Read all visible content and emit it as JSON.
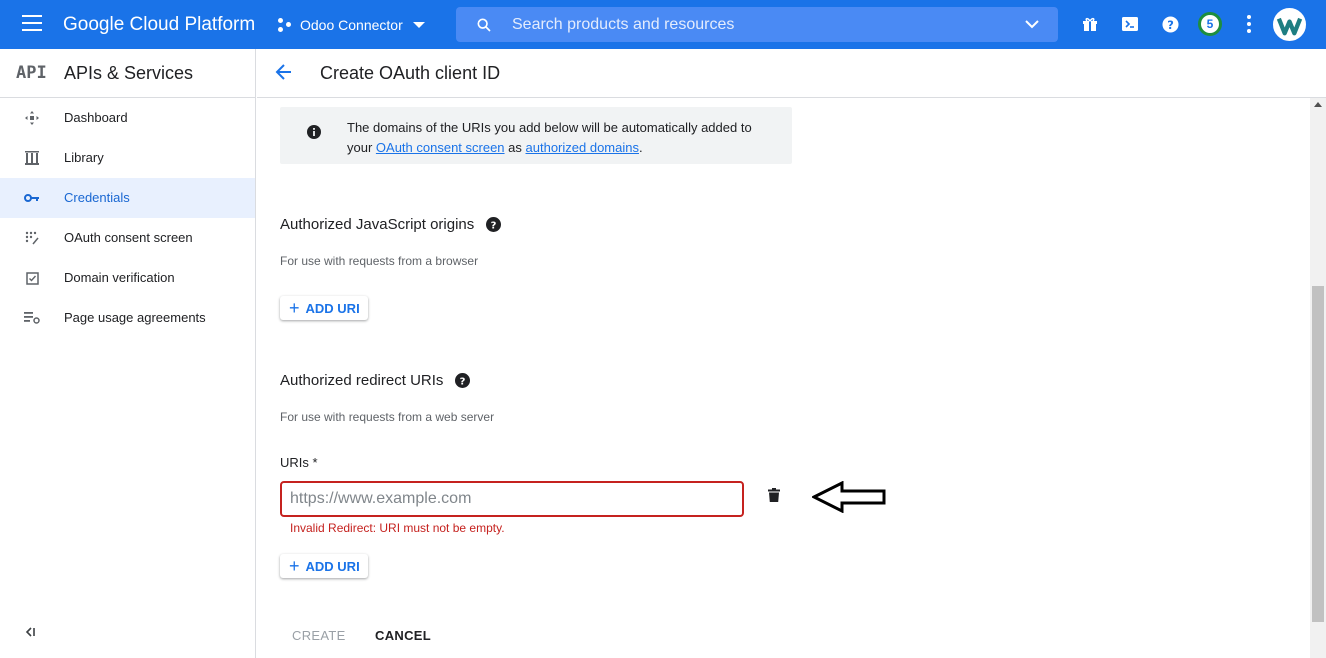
{
  "topbar": {
    "brand": "Google Cloud Platform",
    "project": "Odoo Connector",
    "search_placeholder": "Search products and resources",
    "notifications_count": "5"
  },
  "sidebar": {
    "logo": "API",
    "title": "APIs & Services",
    "items": [
      {
        "label": "Dashboard",
        "icon": "dashboard-icon",
        "active": false
      },
      {
        "label": "Library",
        "icon": "library-icon",
        "active": false
      },
      {
        "label": "Credentials",
        "icon": "key-icon",
        "active": true
      },
      {
        "label": "OAuth consent screen",
        "icon": "consent-icon",
        "active": false
      },
      {
        "label": "Domain verification",
        "icon": "checkbox-icon",
        "active": false
      },
      {
        "label": "Page usage agreements",
        "icon": "settings-list-icon",
        "active": false
      }
    ],
    "collapse_label": "<|"
  },
  "page": {
    "title": "Create OAuth client ID"
  },
  "info": {
    "text_1": "The domains of the URIs you add below will be automatically added to your ",
    "link_1": "OAuth consent screen",
    "text_2": " as ",
    "link_2": "authorized domains",
    "text_3": "."
  },
  "js_origins": {
    "title": "Authorized JavaScript origins",
    "subtitle": "For use with requests from a browser",
    "add_label": "ADD URI"
  },
  "redirect": {
    "title": "Authorized redirect URIs",
    "subtitle": "For use with requests from a web server",
    "field_label": "URIs *",
    "placeholder": "https://www.example.com",
    "value": "",
    "error": "Invalid Redirect: URI must not be empty.",
    "add_label": "ADD URI"
  },
  "actions": {
    "create": "CREATE",
    "cancel": "CANCEL"
  },
  "colors": {
    "primary": "#1a73e8",
    "error": "#c5221f",
    "active_bg": "#e8f0fe"
  }
}
